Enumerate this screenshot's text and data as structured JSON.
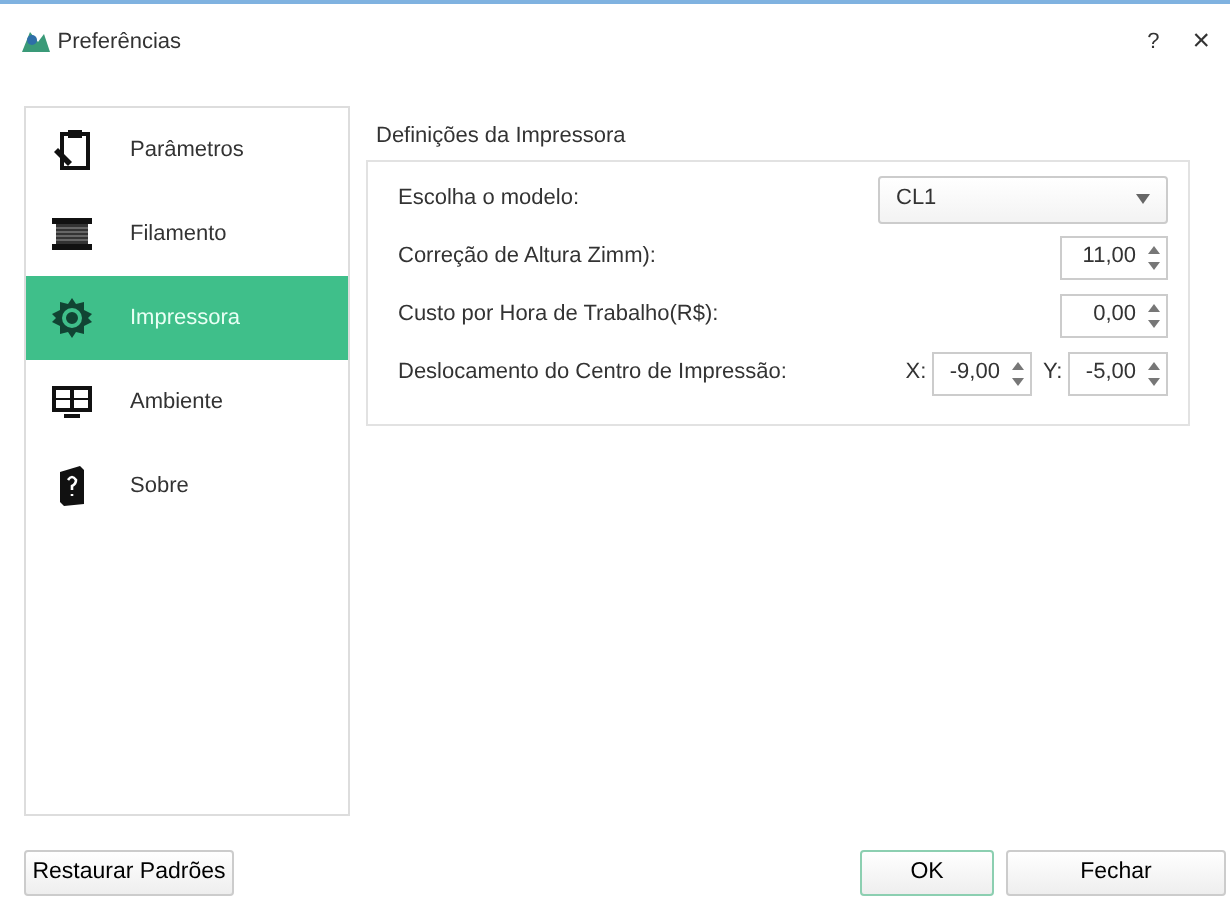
{
  "window": {
    "title": "Preferências",
    "help": "?",
    "close": "×"
  },
  "sidebar": {
    "items": [
      {
        "label": "Parâmetros",
        "selected": false
      },
      {
        "label": "Filamento",
        "selected": false
      },
      {
        "label": "Impressora",
        "selected": true
      },
      {
        "label": "Ambiente",
        "selected": false
      },
      {
        "label": "Sobre",
        "selected": false
      }
    ]
  },
  "group": {
    "title": "Definições da Impressora",
    "rows": [
      {
        "kind": "select",
        "label": "Escolha o modelo:",
        "value": "CL1"
      },
      {
        "kind": "spin",
        "label": "Correção de Altura Zimm):",
        "value": "11,00"
      },
      {
        "kind": "spin",
        "label": "Custo por Hora de Trabalho(R$):",
        "value": "0,00"
      },
      {
        "kind": "xy",
        "label": "Deslocamento do Centro de Impressão:",
        "x_label": "X:",
        "x_value": "-9,00",
        "y_label": "Y:",
        "y_value": "-5,00"
      }
    ]
  },
  "buttons": {
    "restore": "Restaurar Padrões",
    "ok": "OK",
    "close": "Fechar"
  }
}
